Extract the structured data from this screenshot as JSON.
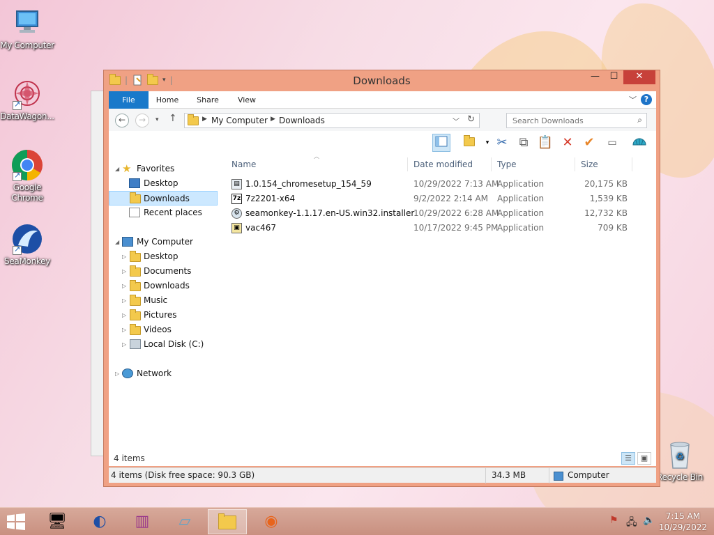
{
  "desktop": {
    "icons": [
      {
        "label": "My Computer",
        "icon": "computer-icon"
      },
      {
        "label": "DataWagon...",
        "icon": "datawagon-icon"
      },
      {
        "label": "Google Chrome",
        "icon": "chrome-icon"
      },
      {
        "label": "SeaMonkey",
        "icon": "seamonkey-icon"
      },
      {
        "label": "Recycle Bin",
        "icon": "recycle-bin-icon"
      }
    ]
  },
  "window": {
    "title": "Downloads",
    "ribbon_tabs": [
      "File",
      "Home",
      "Share",
      "View"
    ],
    "address": {
      "crumbs": [
        "My Computer",
        "Downloads"
      ]
    },
    "search": {
      "placeholder": "Search Downloads"
    },
    "nav": {
      "favorites": "Favorites",
      "favorites_items": [
        "Desktop",
        "Downloads",
        "Recent places"
      ],
      "computer": "My Computer",
      "computer_items": [
        "Desktop",
        "Documents",
        "Downloads",
        "Music",
        "Pictures",
        "Videos",
        "Local Disk (C:)"
      ],
      "network": "Network"
    },
    "columns": [
      "Name",
      "Date modified",
      "Type",
      "Size"
    ],
    "files": [
      {
        "name": "1.0.154_chromesetup_154_59",
        "date": "10/29/2022 7:13 AM",
        "type": "Application",
        "size": "20,175 KB"
      },
      {
        "name": "7z2201-x64",
        "date": "9/2/2022 2:14 AM",
        "type": "Application",
        "size": "1,539 KB"
      },
      {
        "name": "seamonkey-1.1.17.en-US.win32.installer",
        "date": "10/29/2022 6:28 AM",
        "type": "Application",
        "size": "12,732 KB"
      },
      {
        "name": "vac467",
        "date": "10/17/2022 9:45 PM",
        "type": "Application",
        "size": "709 KB"
      }
    ],
    "item_count": "4 items",
    "status": {
      "summary": "4 items (Disk free space: 90.3 GB)",
      "size": "34.3 MB",
      "location": "Computer"
    }
  },
  "taskbar": {
    "clock_time": "7:15 AM",
    "clock_date": "10/29/2022"
  },
  "colors": {
    "accent": "#1979ca",
    "window_frame": "#f0a184",
    "close_button": "#c7413a"
  }
}
